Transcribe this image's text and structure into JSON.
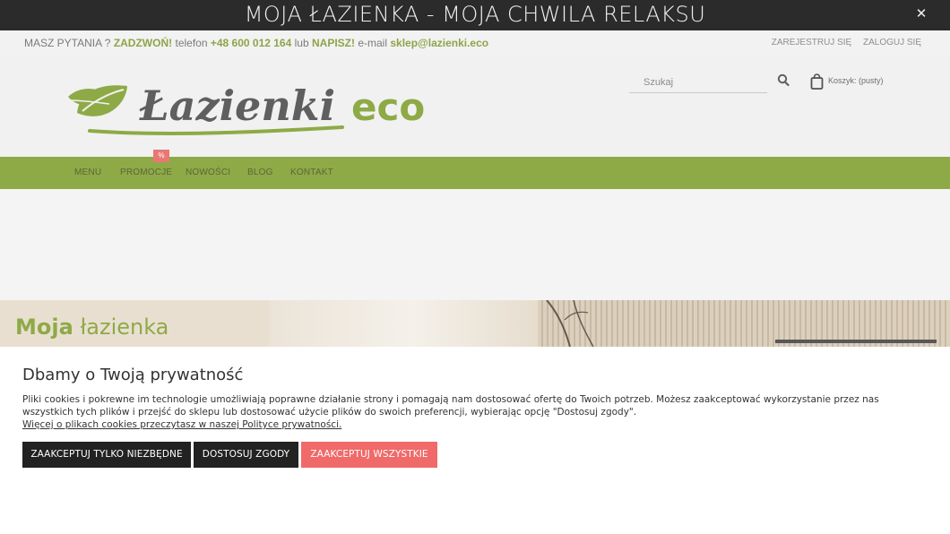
{
  "announcement": {
    "title": "MOJA ŁAZIENKA - MOJA CHWILA RELAKSU",
    "close_icon": "close-icon"
  },
  "contact": {
    "question": "MASZ PYTANIA ?",
    "call": "ZADZWOŃ!",
    "phone_label": "telefon",
    "phone": "+48 600 012 164",
    "or": "lub",
    "write": "NAPISZ!",
    "email_label": "e-mail",
    "email": "sklep@lazienki.eco",
    "register": "ZAREJESTRUJ SIĘ",
    "login": "ZALOGUJ SIĘ"
  },
  "header": {
    "logo_text": "Łazienki",
    "logo_eco": "eco",
    "search_placeholder": "Szukaj",
    "cart_label": "Koszyk: (pusty)"
  },
  "nav": {
    "items": [
      "MENU",
      "PROMOCJE",
      "NOWOŚCI",
      "BLOG",
      "KONTAKT"
    ],
    "promo_badge": "%"
  },
  "hero": {
    "title_bold": "Moja",
    "title_rest": "łazienka"
  },
  "cookie": {
    "heading": "Dbamy o Twoją prywatność",
    "body": "Pliki cookies i pokrewne im technologie umożliwiają poprawne działanie strony i pomagają nam dostosować ofertę do Twoich potrzeb. Możesz zaakceptować wykorzystanie przez nas wszystkich tych plików i przejść do sklepu lub dostosować użycie plików do swoich preferencji, wybierając opcję \"Dostosuj zgody\".",
    "more": "Więcej o plikach cookies przeczytasz w naszej Polityce prywatności.",
    "btn_necessary": "ZAAKCEPTUJ TYLKO NIEZBĘDNE",
    "btn_customize": "DOSTOSUJ ZGODY",
    "btn_all": "ZAAKCEPTUJ WSZYSTKIE"
  },
  "colors": {
    "brand_green": "#6f9212",
    "accent_red": "#f06a6a",
    "dark": "#222222"
  }
}
